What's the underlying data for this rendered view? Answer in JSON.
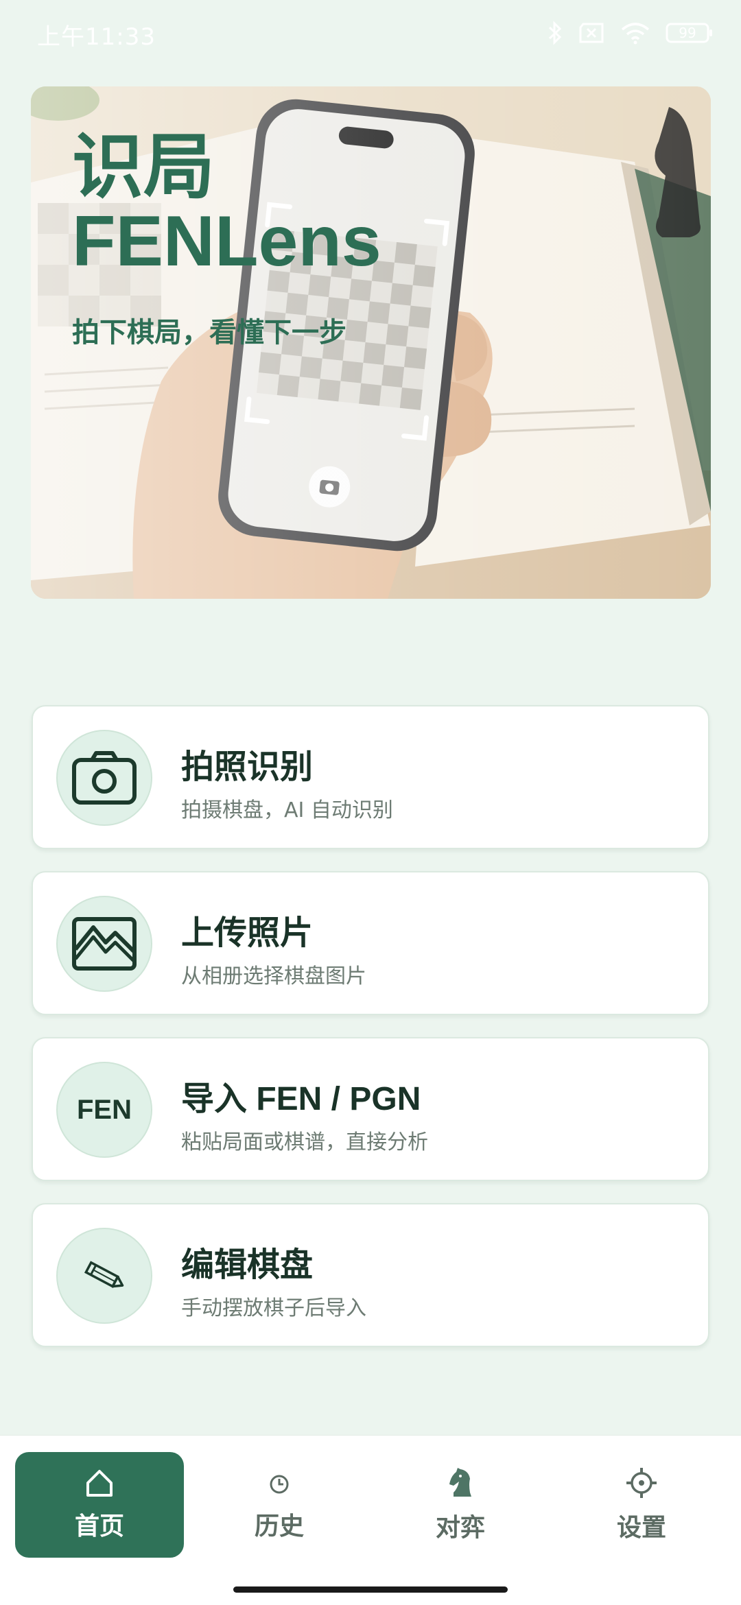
{
  "status_bar": {
    "time": "上午11:33",
    "battery": "99",
    "icons": [
      "bluetooth-icon",
      "sim-x-icon",
      "wifi-icon",
      "battery-icon"
    ]
  },
  "hero": {
    "title_line1": "识局",
    "title_line2": "FENLens",
    "subtitle": "拍下棋局，看懂下一步"
  },
  "actions": [
    {
      "icon": "camera-icon",
      "title": "拍照识别",
      "subtitle": "拍摄棋盘，AI 自动识别"
    },
    {
      "icon": "image-icon",
      "title": "上传照片",
      "subtitle": "从相册选择棋盘图片"
    },
    {
      "icon_text": "FEN",
      "title": "导入 FEN / PGN",
      "subtitle": "粘贴局面或棋谱，直接分析"
    },
    {
      "icon": "pencil-icon",
      "title": "编辑棋盘",
      "subtitle": "手动摆放棋子后导入"
    }
  ],
  "nav": {
    "items": [
      {
        "icon": "home-icon",
        "label": "首页",
        "active": true
      },
      {
        "icon": "history-icon",
        "label": "历史",
        "active": false
      },
      {
        "icon": "knight-icon",
        "label": "对弈",
        "active": false
      },
      {
        "icon": "settings-icon",
        "label": "设置",
        "active": false
      }
    ]
  },
  "colors": {
    "background": "#ecf5ef",
    "accent": "#2f7258",
    "hero_text": "#2d6e55",
    "card_icon_bg": "#e0f1e8"
  }
}
